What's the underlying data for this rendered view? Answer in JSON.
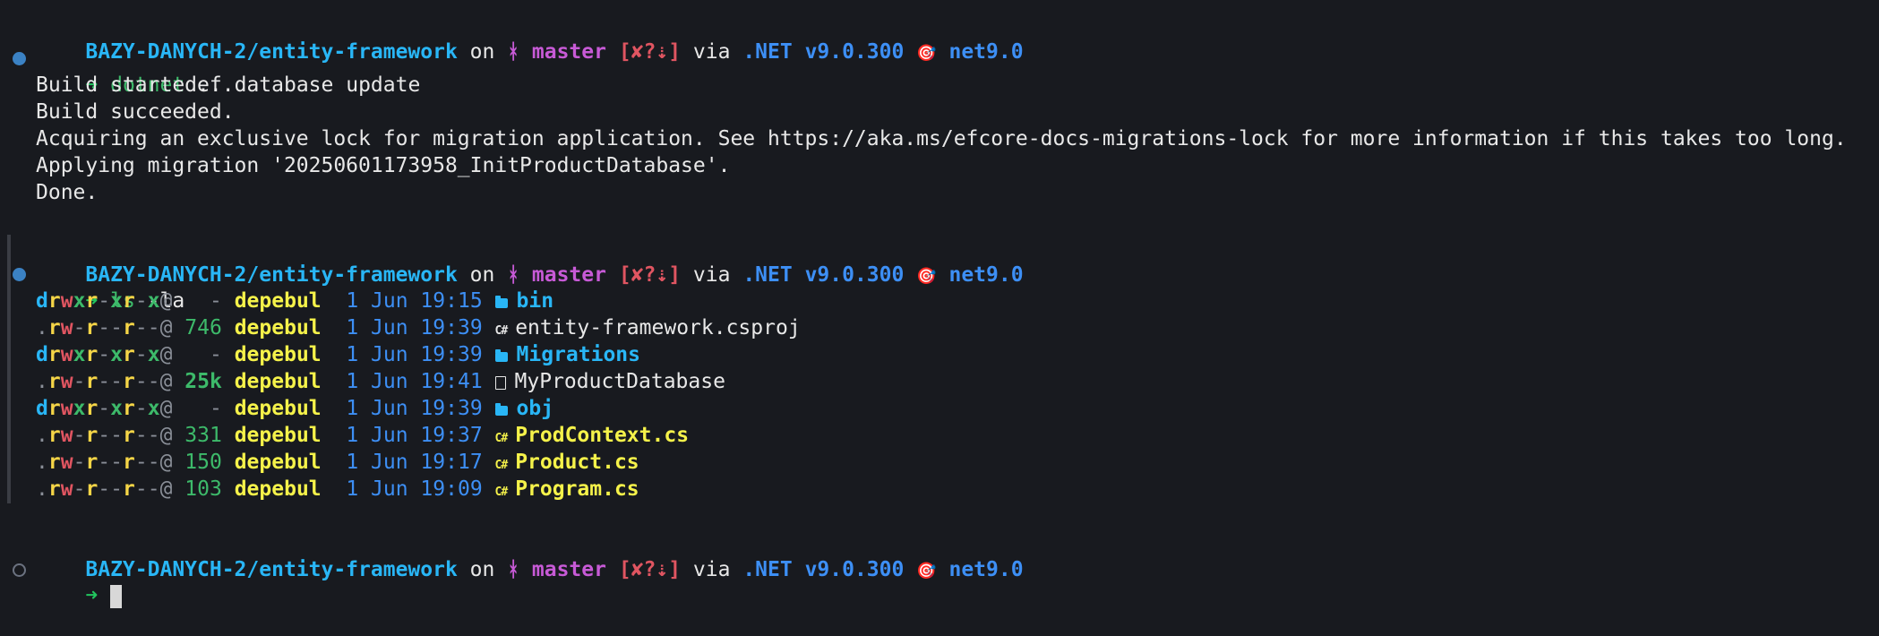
{
  "prompt": {
    "path": "BAZY-DANYCH-2/entity-framework",
    "on": " on ",
    "branch_icon": "ᚼ",
    "branch": "master",
    "status": "[✘?⇣]",
    "via": " via ",
    "net": ".NET v9.0.300",
    "target_icon": "🎯",
    "framework": "net9.0",
    "arrow": "➜"
  },
  "command1": {
    "cmd": "dotnet",
    "args": " ef database update"
  },
  "output1": [
    "Build started...",
    "Build succeeded.",
    "Acquiring an exclusive lock for migration application. See https://aka.ms/efcore-docs-migrations-lock for more information if this takes too long.",
    "Applying migration '20250601173958_InitProductDatabase'.",
    "Done."
  ],
  "command2": {
    "cmd": "ls",
    "args": " -la"
  },
  "listing": [
    {
      "perm_type": "d",
      "size": "-",
      "size_style": "dash",
      "user": "depebul",
      "date": "1 Jun 19:15",
      "kind": "dir",
      "name": "bin"
    },
    {
      "perm_type": ".",
      "size": "746",
      "size_style": "normal",
      "user": "depebul",
      "date": "1 Jun 19:39",
      "kind": "csproj",
      "name": "entity-framework.csproj"
    },
    {
      "perm_type": "d",
      "size": "-",
      "size_style": "dash",
      "user": "depebul",
      "date": "1 Jun 19:39",
      "kind": "dir",
      "name": "Migrations"
    },
    {
      "perm_type": ".",
      "size": "25k",
      "size_style": "bold",
      "user": "depebul",
      "date": "1 Jun 19:41",
      "kind": "file",
      "name": "MyProductDatabase"
    },
    {
      "perm_type": "d",
      "size": "-",
      "size_style": "dash",
      "user": "depebul",
      "date": "1 Jun 19:39",
      "kind": "dir",
      "name": "obj"
    },
    {
      "perm_type": ".",
      "size": "331",
      "size_style": "normal",
      "user": "depebul",
      "date": "1 Jun 19:37",
      "kind": "cs",
      "name": "ProdContext.cs"
    },
    {
      "perm_type": ".",
      "size": "150",
      "size_style": "normal",
      "user": "depebul",
      "date": "1 Jun 19:17",
      "kind": "cs",
      "name": "Product.cs"
    },
    {
      "perm_type": ".",
      "size": "103",
      "size_style": "normal",
      "user": "depebul",
      "date": "1 Jun 19:09",
      "kind": "cs",
      "name": "Program.cs"
    }
  ],
  "perms": {
    "dir": "rwxr-xr-x@",
    "file": "rw-r--r--@"
  },
  "cs_glyph": "C#"
}
